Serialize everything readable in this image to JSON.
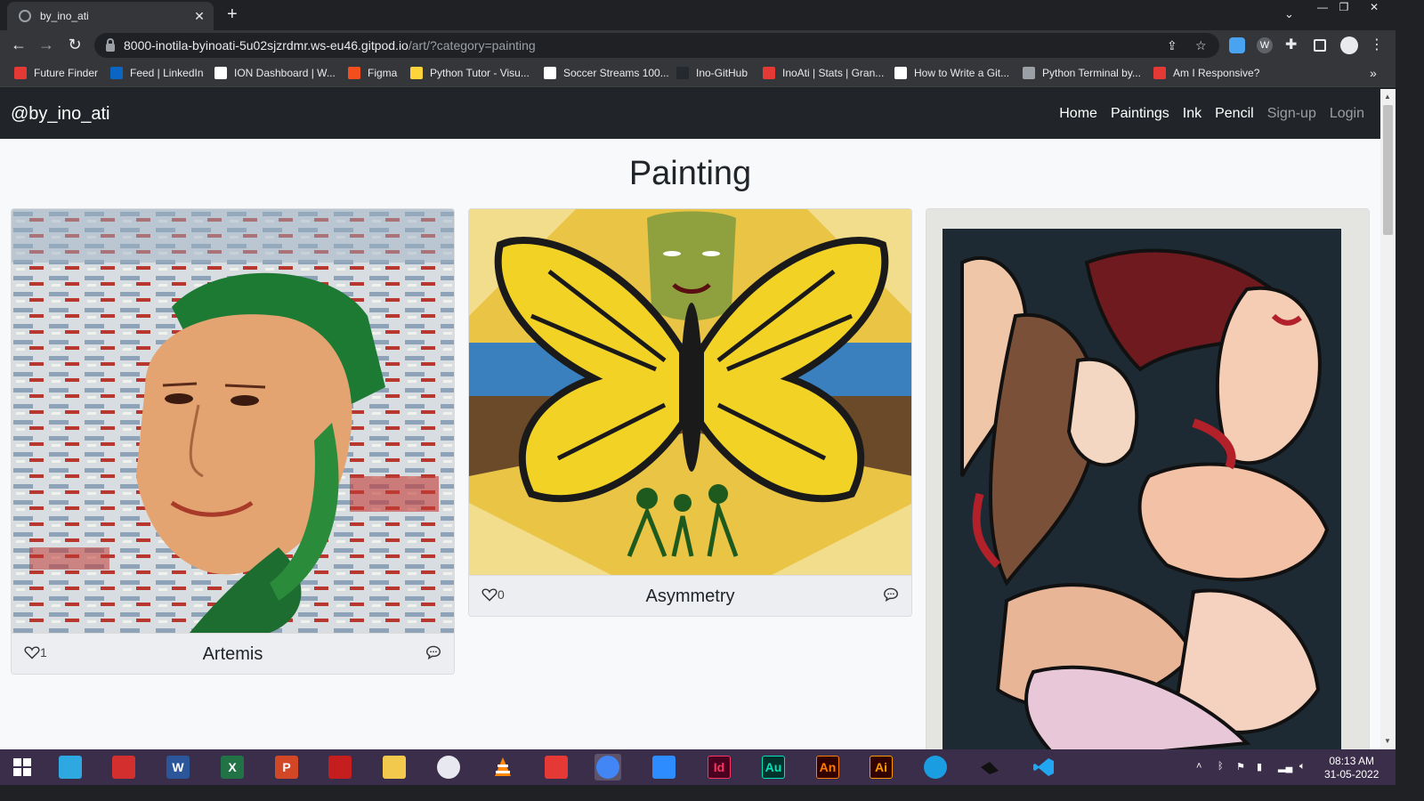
{
  "browser": {
    "tab_title": "by_ino_ati",
    "url_main": "8000-inotila-byinoati-5u02sjzrdmr.ws-eu46.gitpod.io",
    "url_path": "/art/?category=painting",
    "bookmarks": [
      {
        "label": "Future Finder",
        "color": "#e53935"
      },
      {
        "label": "Feed | LinkedIn",
        "color": "#0a66c2"
      },
      {
        "label": "ION Dashboard | W...",
        "color": "#ffffff"
      },
      {
        "label": "Figma",
        "color": "#f24e1e"
      },
      {
        "label": "Python Tutor - Visu...",
        "color": "#ffd43b"
      },
      {
        "label": "Soccer Streams 100...",
        "color": "#ffffff"
      },
      {
        "label": "Ino-GitHub",
        "color": "#24292f"
      },
      {
        "label": "InoAti | Stats | Gran...",
        "color": "#e53935"
      },
      {
        "label": "How to Write a Git...",
        "color": "#ffffff"
      },
      {
        "label": "Python Terminal by...",
        "color": "#9aa0a6"
      },
      {
        "label": "Am I Responsive?",
        "color": "#e53935"
      }
    ]
  },
  "navbar": {
    "brand": "@by_ino_ati",
    "links": [
      {
        "label": "Home",
        "state": "active"
      },
      {
        "label": "Paintings",
        "state": "active"
      },
      {
        "label": "Ink",
        "state": "active"
      },
      {
        "label": "Pencil",
        "state": "active"
      },
      {
        "label": "Sign-up",
        "state": "dim"
      },
      {
        "label": "Login",
        "state": "dim"
      }
    ]
  },
  "page": {
    "heading": "Painting",
    "cards": [
      {
        "title": "Artemis",
        "likes": "1"
      },
      {
        "title": "Asymmetry",
        "likes": "0"
      },
      {
        "title": "",
        "likes": ""
      }
    ]
  },
  "taskbar": {
    "time": "08:13 AM",
    "date": "31-05-2022",
    "apps": [
      {
        "name": "windows-start-icon",
        "label": ""
      },
      {
        "name": "control-icon",
        "label": ""
      },
      {
        "name": "app-red-icon",
        "label": ""
      },
      {
        "name": "word-icon",
        "label": "W"
      },
      {
        "name": "excel-icon",
        "label": "X"
      },
      {
        "name": "powerpoint-icon",
        "label": "P"
      },
      {
        "name": "acrobat-icon",
        "label": ""
      },
      {
        "name": "file-explorer-icon",
        "label": ""
      },
      {
        "name": "itunes-icon",
        "label": ""
      },
      {
        "name": "vlc-icon",
        "label": ""
      },
      {
        "name": "target-app-icon",
        "label": ""
      },
      {
        "name": "chrome-icon",
        "label": ""
      },
      {
        "name": "zoom-icon",
        "label": ""
      },
      {
        "name": "indesign-icon",
        "label": "Id"
      },
      {
        "name": "audition-icon",
        "label": "Au"
      },
      {
        "name": "animate-icon",
        "label": "An"
      },
      {
        "name": "illustrator-icon",
        "label": "Ai"
      },
      {
        "name": "edge-icon",
        "label": ""
      },
      {
        "name": "app-dark-icon",
        "label": ""
      },
      {
        "name": "vscode-icon",
        "label": ""
      }
    ]
  }
}
